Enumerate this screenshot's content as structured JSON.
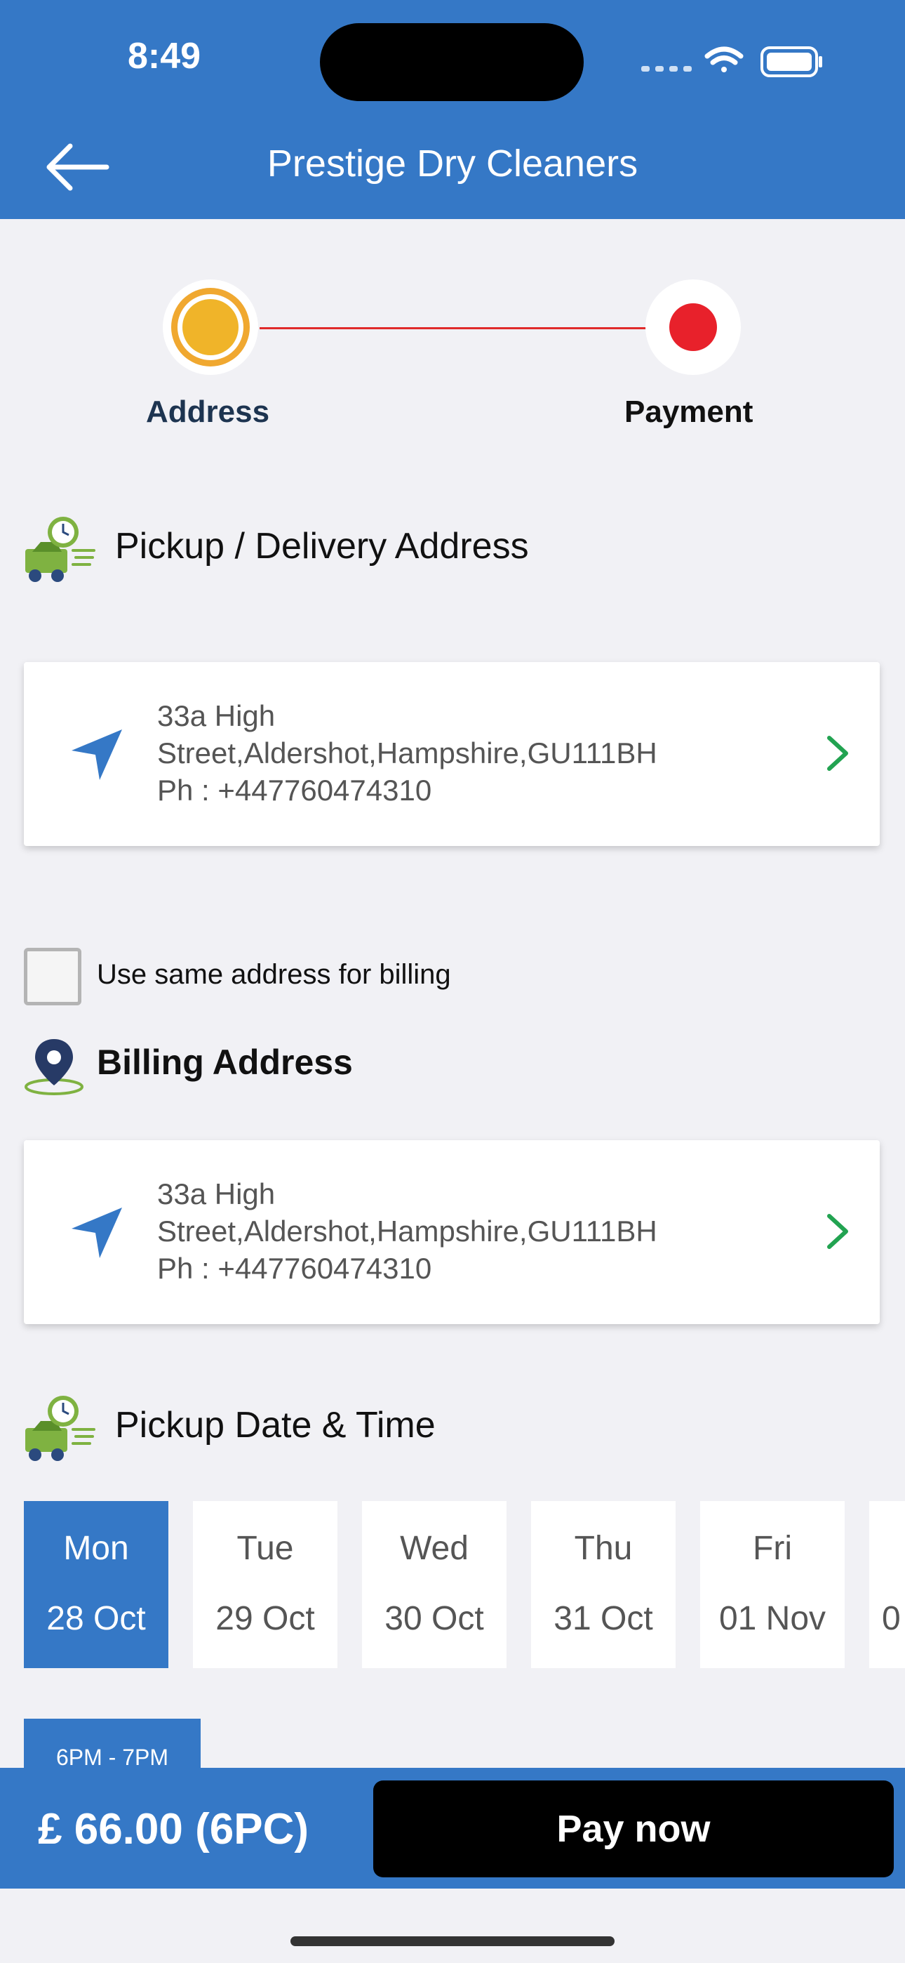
{
  "status_bar": {
    "time": "8:49"
  },
  "header": {
    "title": "Prestige Dry Cleaners"
  },
  "stepper": {
    "step1_label": "Address",
    "step2_label": "Payment"
  },
  "pickup_section": {
    "title": "Pickup / Delivery Address",
    "address_line1": "33a High",
    "address_line2": "Street,Aldershot,Hampshire,GU111BH",
    "phone": "Ph : +447760474310"
  },
  "billing_checkbox": {
    "label": "Use same address for billing",
    "checked": false
  },
  "billing_section": {
    "title": "Billing Address",
    "address_line1": "33a High",
    "address_line2": "Street,Aldershot,Hampshire,GU111BH",
    "phone": "Ph : +447760474310"
  },
  "date_section": {
    "title": "Pickup Date & Time",
    "days": [
      {
        "name": "Mon",
        "date": "28 Oct",
        "selected": true
      },
      {
        "name": "Tue",
        "date": "29 Oct",
        "selected": false
      },
      {
        "name": "Wed",
        "date": "30 Oct",
        "selected": false
      },
      {
        "name": "Thu",
        "date": "31 Oct",
        "selected": false
      },
      {
        "name": "Fri",
        "date": "01 Nov",
        "selected": false
      },
      {
        "name": "",
        "date": "0",
        "selected": false
      }
    ],
    "time_slot": "6PM - 7PM"
  },
  "footer": {
    "price": "£ 66.00 (6PC)",
    "pay_label": "Pay now"
  },
  "colors": {
    "primary": "#3578c6",
    "accent_orange": "#f0b429",
    "accent_red": "#e8212b",
    "green": "#22a351"
  }
}
